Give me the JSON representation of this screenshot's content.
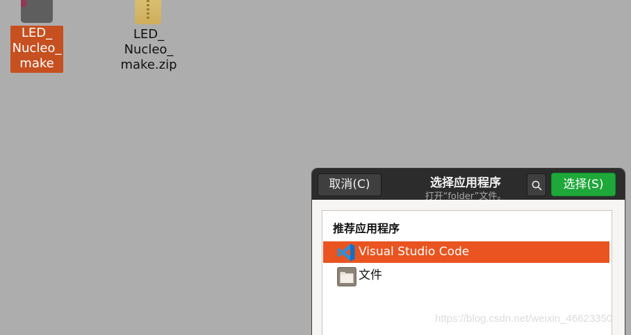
{
  "desktop": {
    "items": [
      {
        "label": "LED_\nNucleo_\nmake",
        "selected": true,
        "icon": "folder-icon"
      },
      {
        "label": "LED_\nNucleo_\nmake.zip",
        "selected": false,
        "icon": "zip-archive-icon"
      }
    ]
  },
  "dialog": {
    "title": "选择应用程序",
    "subtitle": "打开“folder”文件。",
    "cancel_label": "取消(C)",
    "select_label": "选择(S)",
    "search_icon": "search-icon",
    "section_heading": "推荐应用程序",
    "apps": [
      {
        "name": "Visual Studio Code",
        "icon": "vscode-icon",
        "selected": true
      },
      {
        "name": "文件",
        "icon": "files-icon",
        "selected": false
      }
    ]
  },
  "watermark": "https://blog.csdn.net/weixin_46623350",
  "colors": {
    "desktop_bg": "#adadad",
    "selection_orange": "#e95420",
    "desktop_selection": "#c6501f",
    "select_button_green": "#1ea83a",
    "headerbar": "#2c2c2c"
  }
}
